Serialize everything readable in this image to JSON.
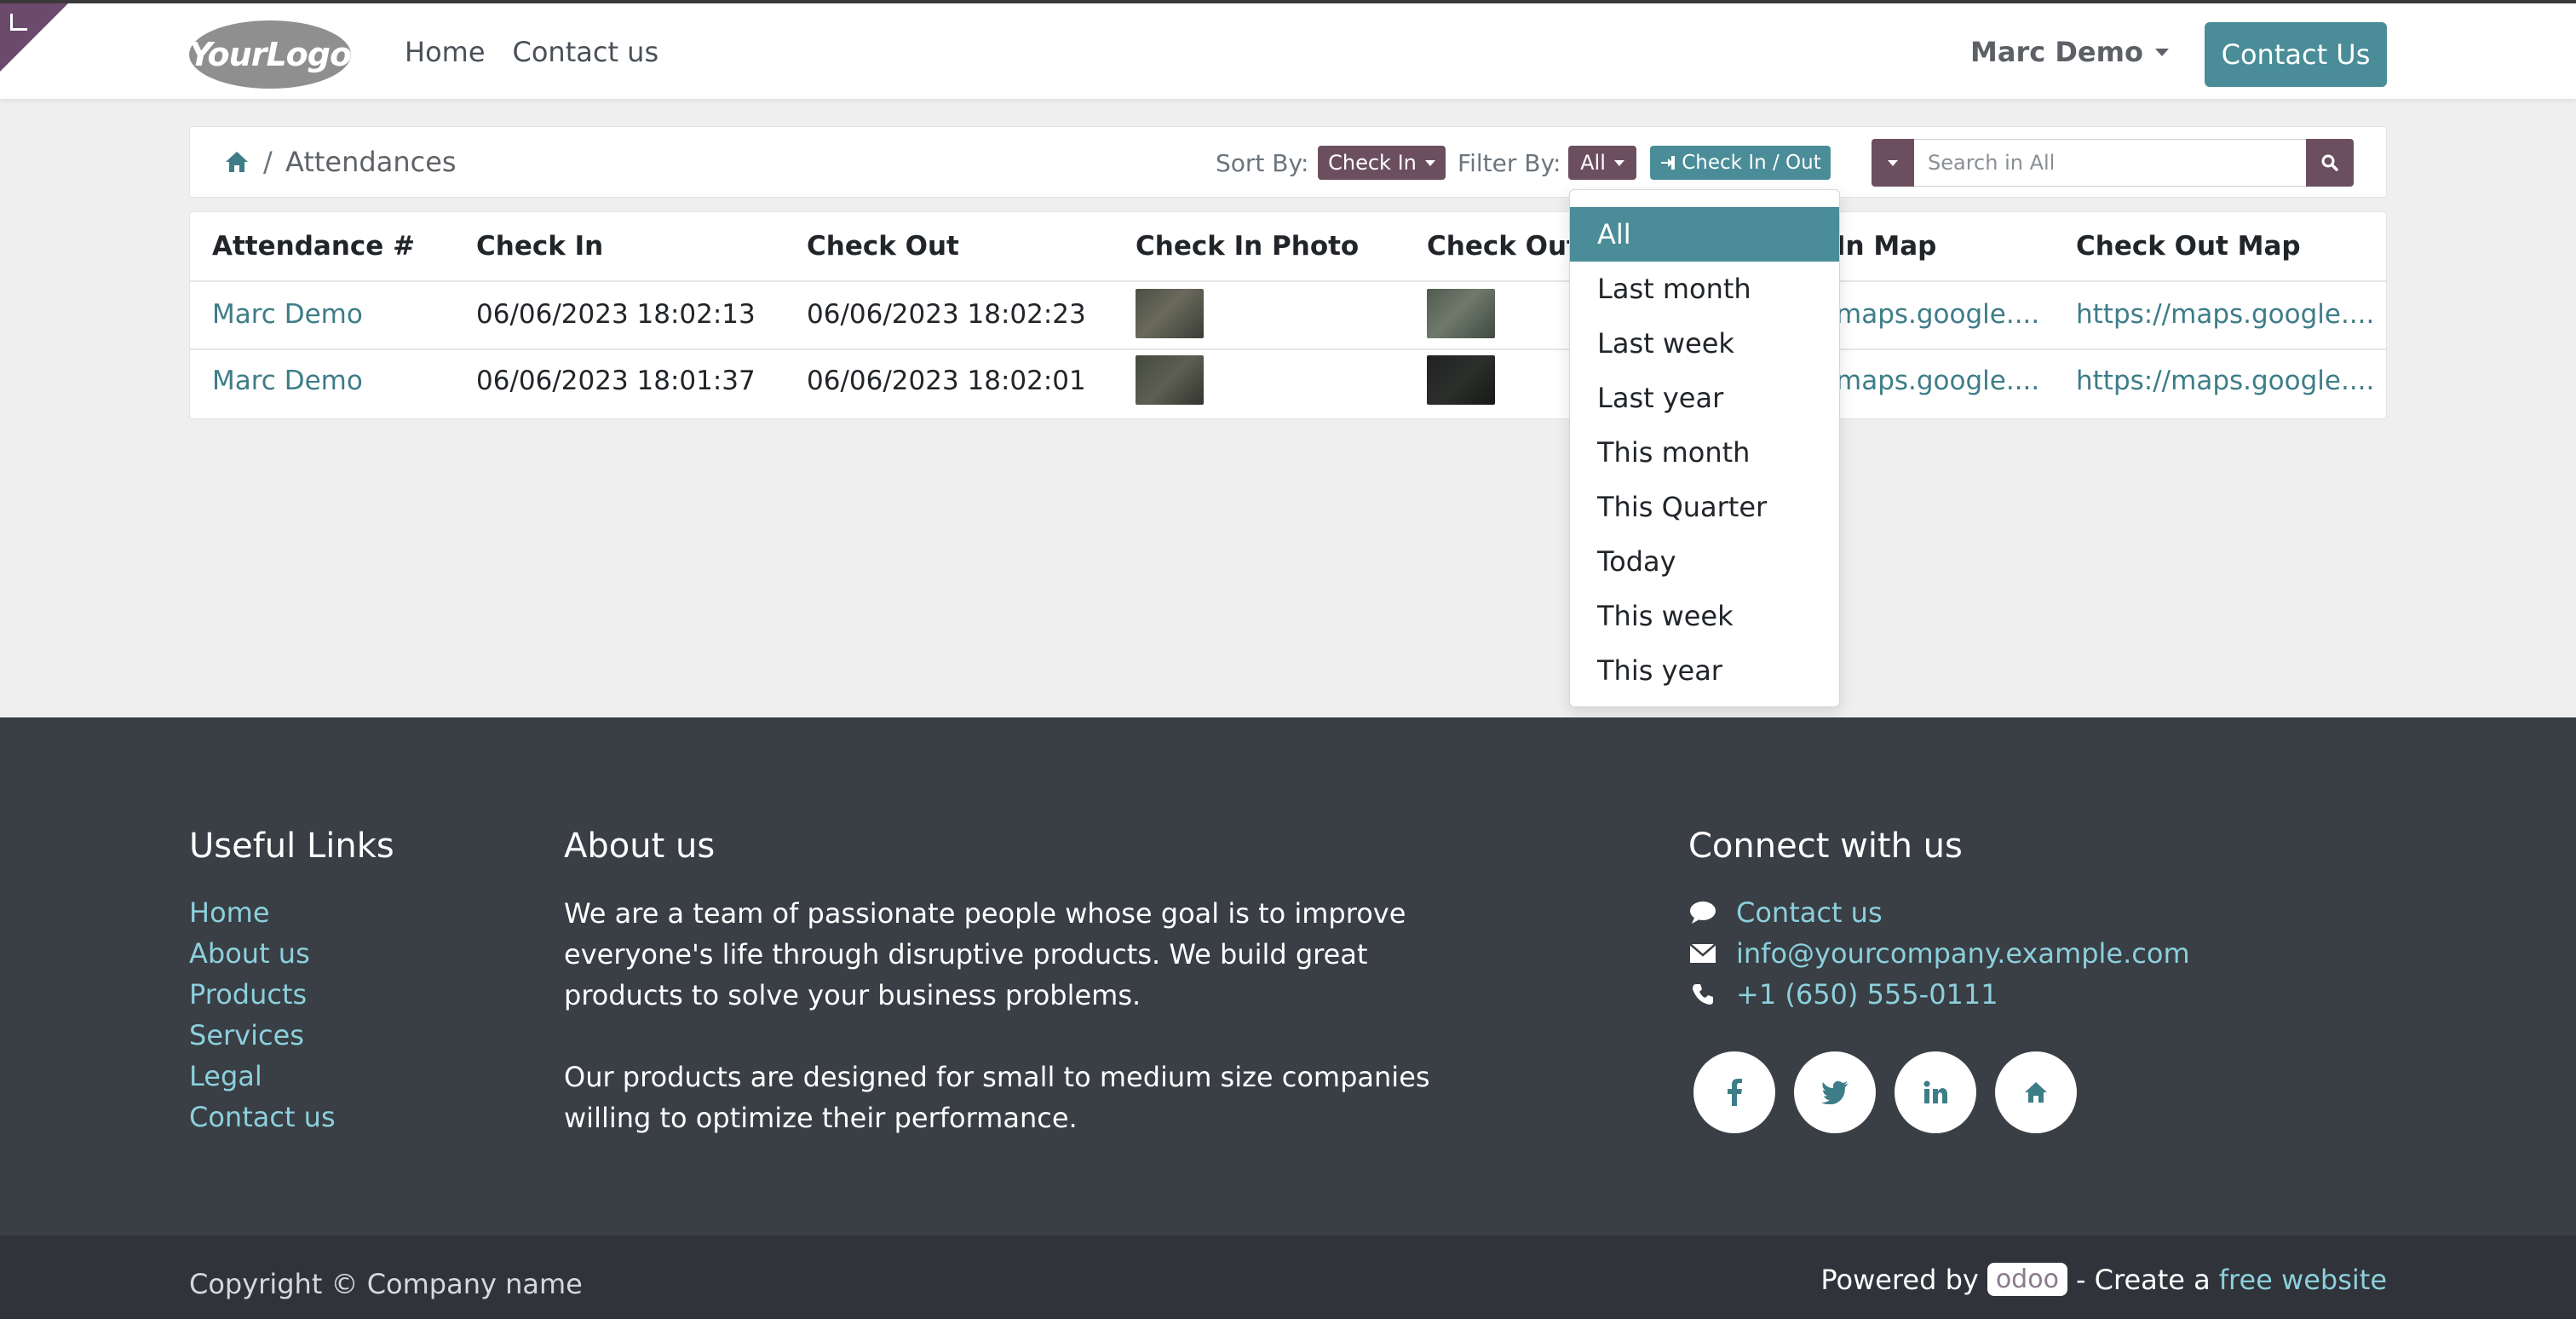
{
  "navbar": {
    "logo_text": "YourLogo",
    "links": [
      "Home",
      "Contact us"
    ],
    "user_name": "Marc Demo",
    "contact_button": "Contact Us"
  },
  "control_bar": {
    "breadcrumb_current": "Attendances",
    "breadcrumb_separator": "/",
    "sort_label": "Sort By:",
    "sort_value": "Check In",
    "filter_label": "Filter By:",
    "filter_value": "All",
    "check_in_out_button": "Check In / Out",
    "search_placeholder": "Search in All"
  },
  "table": {
    "headers": [
      "Attendance #",
      "Check In",
      "Check Out",
      "Check In Photo",
      "Check Out",
      "In Map",
      "Check Out Map"
    ],
    "rows": [
      {
        "name": "Marc Demo",
        "check_in": "06/06/2023 18:02:13",
        "check_out": "06/06/2023 18:02:23",
        "check_in_map": "maps.google....",
        "check_out_map": "https://maps.google...."
      },
      {
        "name": "Marc Demo",
        "check_in": "06/06/2023 18:01:37",
        "check_out": "06/06/2023 18:02:01",
        "check_in_map": "maps.google....",
        "check_out_map": "https://maps.google...."
      }
    ]
  },
  "filter_dropdown": {
    "options": [
      "All",
      "Last month",
      "Last week",
      "Last year",
      "This month",
      "This Quarter",
      "Today",
      "This week",
      "This year"
    ],
    "selected": "All"
  },
  "footer": {
    "useful_links_heading": "Useful Links",
    "useful_links": [
      "Home",
      "About us",
      "Products",
      "Services",
      "Legal",
      "Contact us"
    ],
    "about_heading": "About us",
    "about_p1": "We are a team of passionate people whose goal is to improve everyone's life through disruptive products. We build great products to solve your business problems.",
    "about_p2": "Our products are designed for small to medium size companies willing to optimize their performance.",
    "connect_heading": "Connect with us",
    "contact_link": "Contact us",
    "email": "info@yourcompany.example.com",
    "phone": "+1 (650) 555-0111",
    "socials": [
      "facebook-icon",
      "twitter-icon",
      "linkedin-icon",
      "home-icon"
    ],
    "copyright": "Copyright © Company name",
    "powered_by": "Powered by",
    "odoo": "odoo",
    "create_text": "- Create a",
    "free_website": "free website"
  },
  "colors": {
    "accent_teal": "#4a8d98",
    "accent_purple": "#6b4f5f",
    "footer_bg": "#3a3e45",
    "footer_link": "#8bd0dc"
  }
}
